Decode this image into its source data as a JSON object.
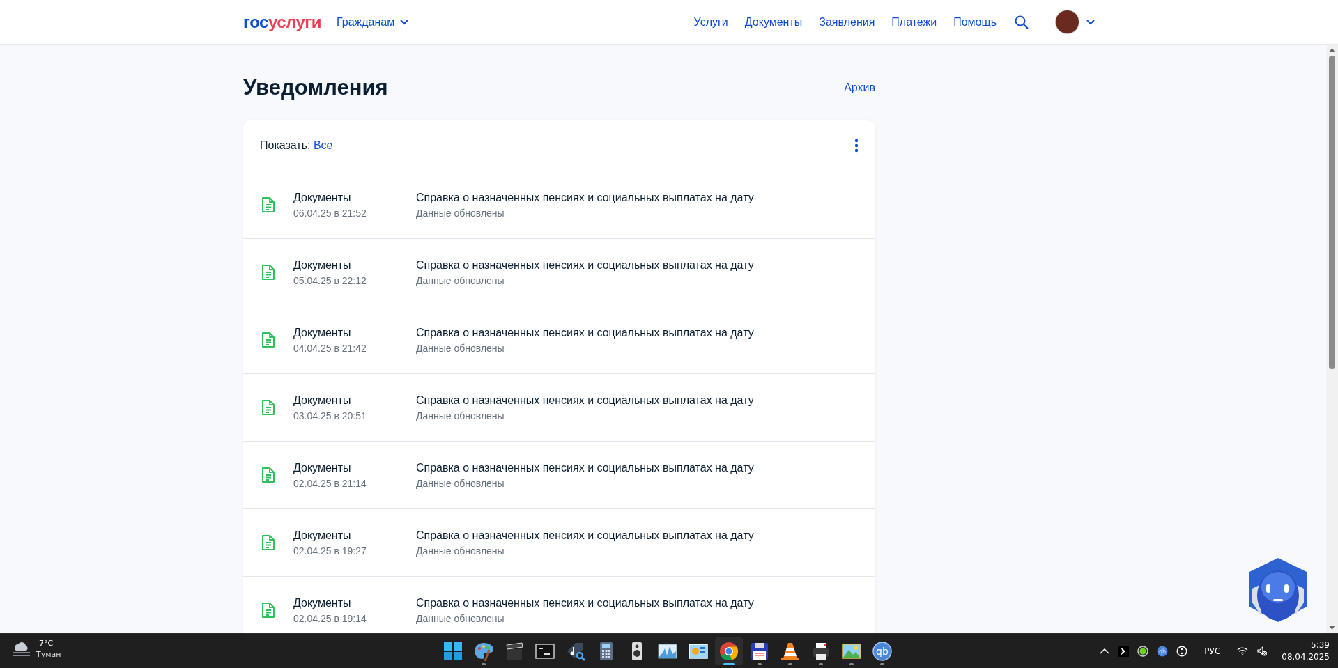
{
  "header": {
    "logo": {
      "part_1": "гос",
      "part_2": "услуги"
    },
    "audience": "Гражданам",
    "nav": [
      "Услуги",
      "Документы",
      "Заявления",
      "Платежи",
      "Помощь"
    ]
  },
  "page": {
    "title": "Уведомления",
    "archive_link": "Архив"
  },
  "filter": {
    "label": "Показать:",
    "value": "Все"
  },
  "notifications": [
    {
      "category": "Документы",
      "date": "06.04.25 в 21:52",
      "title": "Справка о назначенных пенсиях и социальных выплатах на дату",
      "status": "Данные обновлены"
    },
    {
      "category": "Документы",
      "date": "05.04.25 в 22:12",
      "title": "Справка о назначенных пенсиях и социальных выплатах на дату",
      "status": "Данные обновлены"
    },
    {
      "category": "Документы",
      "date": "04.04.25 в 21:42",
      "title": "Справка о назначенных пенсиях и социальных выплатах на дату",
      "status": "Данные обновлены"
    },
    {
      "category": "Документы",
      "date": "03.04.25 в 20:51",
      "title": "Справка о назначенных пенсиях и социальных выплатах на дату",
      "status": "Данные обновлены"
    },
    {
      "category": "Документы",
      "date": "02.04.25 в 21:14",
      "title": "Справка о назначенных пенсиях и социальных выплатах на дату",
      "status": "Данные обновлены"
    },
    {
      "category": "Документы",
      "date": "02.04.25 в 19:27",
      "title": "Справка о назначенных пенсиях и социальных выплатах на дату",
      "status": "Данные обновлены"
    },
    {
      "category": "Документы",
      "date": "02.04.25 в 19:14",
      "title": "Справка о назначенных пенсиях и социальных выплатах на дату",
      "status": "Данные обновлены"
    }
  ],
  "taskbar": {
    "weather": {
      "temperature": "-7°C",
      "condition": "Туман"
    },
    "apps": [
      {
        "kind": "start",
        "running": false,
        "selected": false
      },
      {
        "kind": "paint",
        "running": true,
        "selected": false
      },
      {
        "kind": "clapper",
        "running": false,
        "selected": false
      },
      {
        "kind": "terminal",
        "running": false,
        "selected": false
      },
      {
        "kind": "music",
        "running": false,
        "selected": false
      },
      {
        "kind": "calculator",
        "running": false,
        "selected": false
      },
      {
        "kind": "speaker",
        "running": false,
        "selected": false
      },
      {
        "kind": "chart",
        "running": false,
        "selected": false
      },
      {
        "kind": "monitor",
        "running": false,
        "selected": false
      },
      {
        "kind": "chrome",
        "running": true,
        "selected": true
      },
      {
        "kind": "floppy",
        "running": true,
        "selected": false
      },
      {
        "kind": "cone",
        "running": true,
        "selected": false
      },
      {
        "kind": "printer",
        "running": true,
        "selected": false
      },
      {
        "kind": "photos",
        "running": true,
        "selected": false
      },
      {
        "kind": "qb",
        "label": "qb",
        "running": true,
        "selected": false
      }
    ],
    "tray": {
      "qb_label": "qb",
      "language": "РУС",
      "time": "5:39",
      "date": "08.04.2025"
    }
  }
}
